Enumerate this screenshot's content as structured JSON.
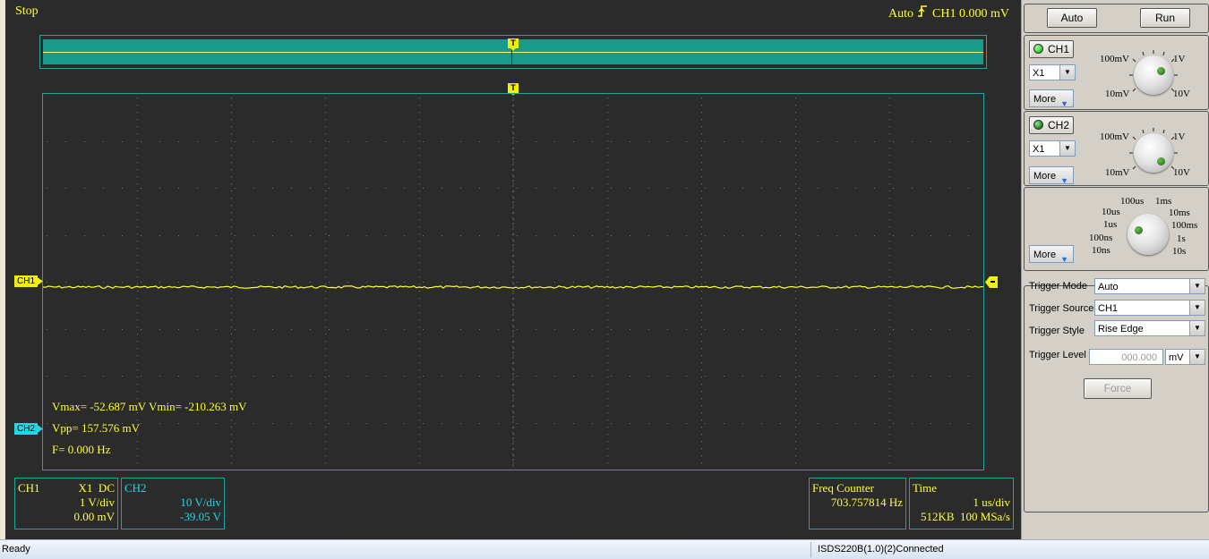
{
  "scope": {
    "run_state": "Stop",
    "trigger_info": {
      "mode": "Auto",
      "channel": "CH1",
      "level": "0.000 mV"
    },
    "trigger_marker": "T",
    "ch1_label": "CH1",
    "ch2_label": "CH2",
    "measurements": {
      "vmax_vmin": "Vmax= -52.687 mV  Vmin= -210.263 mV",
      "vpp": "Vpp= 157.576 mV",
      "freq": "F= 0.000 Hz"
    },
    "info": {
      "ch1": {
        "name": "CH1",
        "probe_coupling": "X1  DC",
        "scale": "1 V/div",
        "offset": "0.00 mV"
      },
      "ch2": {
        "name": "CH2",
        "scale": "10 V/div",
        "offset": "-39.05 V"
      },
      "freq_counter": {
        "title": "Freq Counter",
        "value": "703.757814 Hz"
      },
      "time": {
        "title": "Time",
        "scale": "1 us/div",
        "memory_rate": "512KB  100 MSa/s"
      }
    }
  },
  "panel": {
    "auto_label": "Auto",
    "run_label": "Run",
    "ch1": {
      "label": "CH1",
      "probe": "X1",
      "more": "More",
      "knob": {
        "a": "100mV",
        "b": "1V",
        "c": "10mV",
        "d": "10V"
      },
      "led_color": "#38d838"
    },
    "ch2": {
      "label": "CH2",
      "probe": "X1",
      "more": "More",
      "knob": {
        "a": "100mV",
        "b": "1V",
        "c": "10mV",
        "d": "10V"
      },
      "led_color": "#2f9a2f"
    },
    "timebase": {
      "more": "More",
      "labels": {
        "t100us": "100us",
        "t1ms": "1ms",
        "t10us": "10us",
        "t10ms": "10ms",
        "t1us": "1us",
        "t100ms": "100ms",
        "t100ns": "100ns",
        "t1s": "1s",
        "t10ns": "10ns",
        "t10s": "10s"
      }
    },
    "trigger": {
      "mode_label": "Trigger Mode",
      "mode_value": "Auto",
      "source_label": "Trigger Source",
      "source_value": "CH1",
      "style_label": "Trigger Style",
      "style_value": "Rise Edge",
      "level_label": "Trigger Level",
      "level_placeholder": "000.000",
      "level_unit": "mV",
      "force_label": "Force"
    }
  },
  "status_bar": {
    "left": "Ready",
    "right": "ISDS220B(1.0)(2)Connected"
  },
  "colors": {
    "ch1": "#ffff33",
    "ch2": "#22d8e6",
    "grid_border": "#1fa39a",
    "screen_bg": "#2b2b2b"
  }
}
